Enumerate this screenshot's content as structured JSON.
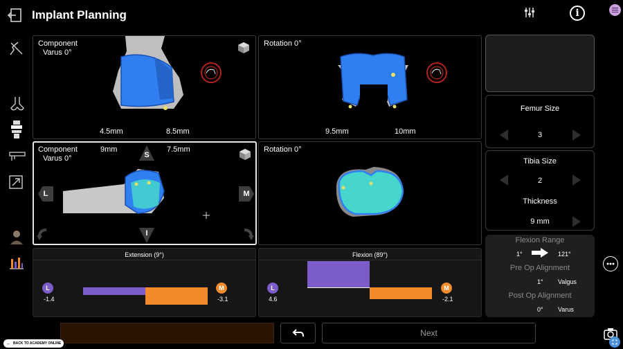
{
  "header": {
    "title": "Implant Planning"
  },
  "colors": {
    "implant_blue": "#2f7ff0",
    "implant_teal": "#47d6cc",
    "bar_purple": "#7b5cc9",
    "bar_orange": "#f08a2a",
    "ring_red": "#b22222"
  },
  "views": {
    "top_left": {
      "label1": "Component",
      "label2": "Varus 0°",
      "m_left": "4.5mm",
      "m_right": "8.5mm"
    },
    "top_right": {
      "label": "Rotation 0°",
      "m_left": "9.5mm",
      "m_right": "10mm"
    },
    "bottom_left": {
      "label1": "Component",
      "label2": "Varus 0°",
      "m_left": "9mm",
      "m_right": "7.5mm",
      "dir_s": "S",
      "dir_i": "I",
      "dir_l": "L",
      "dir_m": "M"
    },
    "bottom_right": {
      "label": "Rotation 0°"
    }
  },
  "gaps": {
    "extension": {
      "title": "Extension (9°)",
      "l_badge": "L",
      "l_value": "-1.4",
      "m_badge": "M",
      "m_value": "-3.1",
      "l_bar": -1.4,
      "m_bar": -3.1
    },
    "flexion": {
      "title": "Flexion (89°)",
      "l_badge": "L",
      "l_value": "4.6",
      "m_badge": "M",
      "m_value": "-2.1",
      "l_bar": 4.6,
      "m_bar": -2.1
    }
  },
  "femur": {
    "label": "Femur Size",
    "value": "3"
  },
  "tibia": {
    "label": "Tibia Size",
    "value": "2",
    "thickness_label": "Thickness",
    "thickness_value": "9 mm"
  },
  "info": {
    "flexion_range_label": "Flexion Range",
    "flexion_min": "1°",
    "flexion_max": "121°",
    "preop_label": "Pre Op Alignment",
    "preop_value": "1°",
    "preop_type": "Valgus",
    "postop_label": "Post Op Alignment",
    "postop_value": "0°",
    "postop_type": "Varus"
  },
  "footer": {
    "next_label": "Next",
    "back_academy": "BACK TO ACADEMY ONLINE"
  }
}
